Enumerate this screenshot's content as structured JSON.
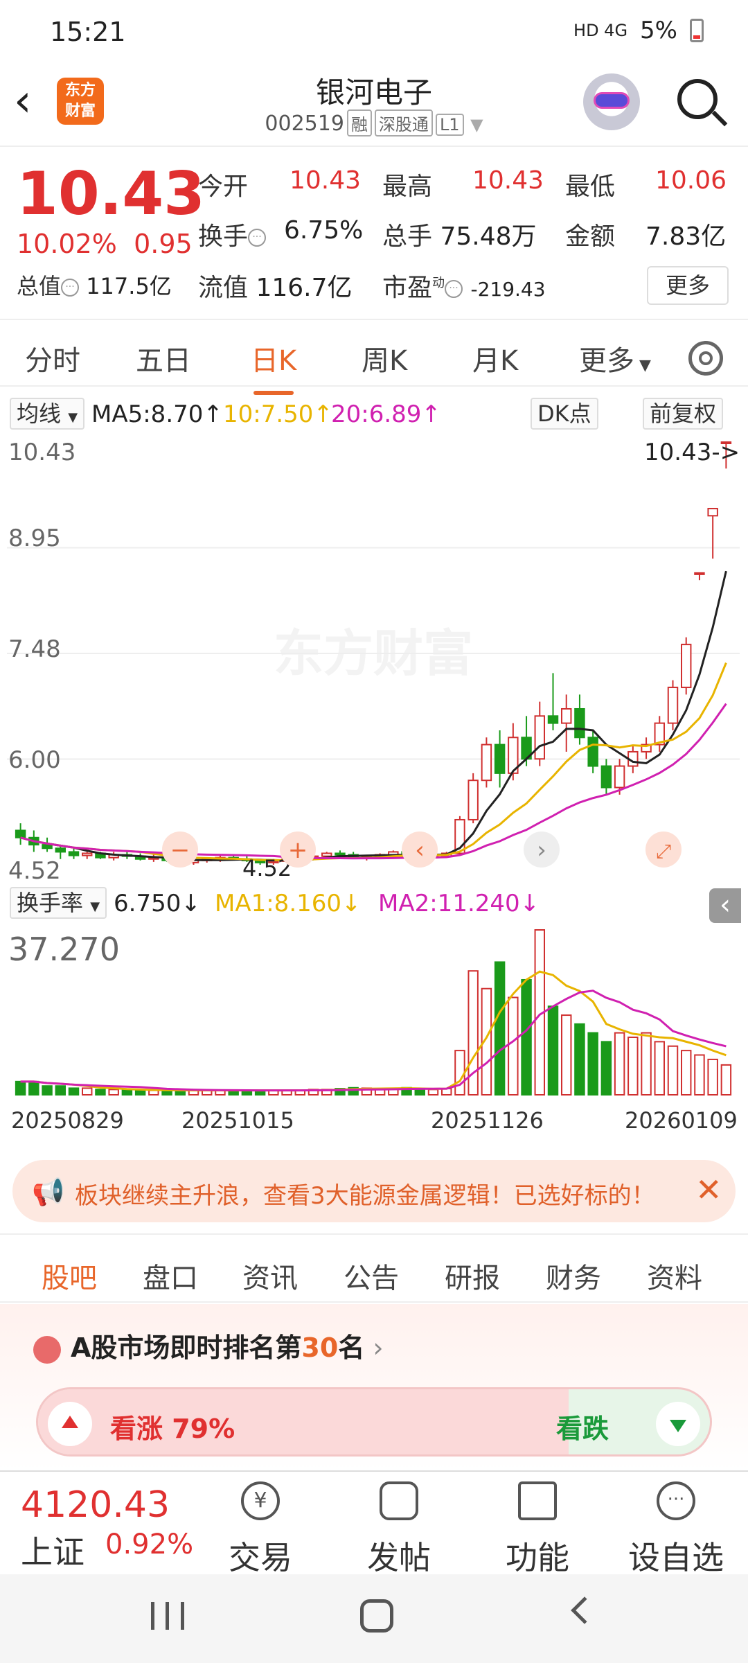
{
  "status_bar": {
    "time": "15:21",
    "signal": "HD 4G",
    "battery": "5%"
  },
  "header": {
    "back_icon": "chevron-left-icon",
    "logo_line1": "东方",
    "logo_line2": "财富",
    "stock_name": "银河电子",
    "stock_code": "002519",
    "tags": [
      "融",
      "深股通",
      "L1"
    ]
  },
  "quote": {
    "price": "10.43",
    "change_pct": "10.02%",
    "change_amt": "0.95",
    "open_label": "今开",
    "open": "10.43",
    "high_label": "最高",
    "high": "10.43",
    "low_label": "最低",
    "low": "10.06",
    "turnover_label": "换手",
    "turnover": "6.75%",
    "volume_label": "总手",
    "volume": "75.48万",
    "amount_label": "金额",
    "amount": "7.83亿",
    "mktcap_label": "总值",
    "mktcap": "117.5亿",
    "float_label": "流值",
    "float": "116.7亿",
    "pe_label": "市盈",
    "pe_super": "动",
    "pe": "-219.43",
    "more": "更多"
  },
  "chart_tabs": [
    "分时",
    "五日",
    "日K",
    "周K",
    "月K",
    "更多"
  ],
  "chart_tab_active": 2,
  "ma_legend": {
    "selector": "均线",
    "ma5": "MA5:8.70",
    "ma10": "10:7.50",
    "ma20": "20:6.89",
    "dk_button": "DK点",
    "adjust_button": "前复权",
    "colors": {
      "ma5": "#222222",
      "ma10": "#e8b400",
      "ma20": "#d020b0"
    }
  },
  "kline_axis": {
    "labels": [
      "10.43",
      "8.95",
      "7.48",
      "6.00",
      "4.52"
    ],
    "last_price_tag": "10.43->",
    "min_marker": "4.52",
    "watermark": "东方财富"
  },
  "volume_legend": {
    "selector": "换手率",
    "value": "6.750",
    "ma1": "MA1:8.160",
    "ma2": "MA2:11.240",
    "axis_max": "37.270"
  },
  "date_labels": [
    "20250829",
    "20251015",
    "20251126",
    "20260109"
  ],
  "chart_data": {
    "type": "candlestick",
    "ylim": [
      4.52,
      10.43
    ],
    "ohlc": [
      [
        5.0,
        5.1,
        4.8,
        4.9
      ],
      [
        4.9,
        5.0,
        4.7,
        4.8
      ],
      [
        4.8,
        4.9,
        4.7,
        4.75
      ],
      [
        4.75,
        4.8,
        4.6,
        4.7
      ],
      [
        4.7,
        4.75,
        4.6,
        4.65
      ],
      [
        4.65,
        4.7,
        4.6,
        4.68
      ],
      [
        4.68,
        4.7,
        4.6,
        4.62
      ],
      [
        4.62,
        4.7,
        4.58,
        4.66
      ],
      [
        4.66,
        4.7,
        4.6,
        4.64
      ],
      [
        4.64,
        4.68,
        4.58,
        4.6
      ],
      [
        4.6,
        4.66,
        4.56,
        4.62
      ],
      [
        4.62,
        4.66,
        4.56,
        4.58
      ],
      [
        4.58,
        4.62,
        4.52,
        4.55
      ],
      [
        4.55,
        4.6,
        4.52,
        4.58
      ],
      [
        4.58,
        4.62,
        4.55,
        4.6
      ],
      [
        4.6,
        4.65,
        4.56,
        4.62
      ],
      [
        4.62,
        4.66,
        4.58,
        4.6
      ],
      [
        4.6,
        4.64,
        4.56,
        4.58
      ],
      [
        4.58,
        4.6,
        4.52,
        4.55
      ],
      [
        4.55,
        4.6,
        4.52,
        4.57
      ],
      [
        4.57,
        4.62,
        4.54,
        4.6
      ],
      [
        4.6,
        4.64,
        4.58,
        4.62
      ],
      [
        4.62,
        4.66,
        4.6,
        4.64
      ],
      [
        4.64,
        4.7,
        4.62,
        4.68
      ],
      [
        4.68,
        4.72,
        4.64,
        4.66
      ],
      [
        4.66,
        4.7,
        4.6,
        4.62
      ],
      [
        4.62,
        4.66,
        4.58,
        4.64
      ],
      [
        4.64,
        4.68,
        4.62,
        4.66
      ],
      [
        4.66,
        4.72,
        4.64,
        4.7
      ],
      [
        4.7,
        4.74,
        4.66,
        4.68
      ],
      [
        4.68,
        4.7,
        4.6,
        4.62
      ],
      [
        4.62,
        4.66,
        4.58,
        4.64
      ],
      [
        4.64,
        4.7,
        4.62,
        4.68
      ],
      [
        4.68,
        5.2,
        4.66,
        5.15
      ],
      [
        5.15,
        5.8,
        5.1,
        5.7
      ],
      [
        5.7,
        6.3,
        5.6,
        6.2
      ],
      [
        6.2,
        6.4,
        5.6,
        5.8
      ],
      [
        5.8,
        6.5,
        5.7,
        6.3
      ],
      [
        6.3,
        6.6,
        5.9,
        6.0
      ],
      [
        6.0,
        6.8,
        5.9,
        6.6
      ],
      [
        6.6,
        7.2,
        6.4,
        6.5
      ],
      [
        6.5,
        6.9,
        6.1,
        6.7
      ],
      [
        6.7,
        6.9,
        6.2,
        6.3
      ],
      [
        6.3,
        6.4,
        5.8,
        5.9
      ],
      [
        5.9,
        6.0,
        5.5,
        5.6
      ],
      [
        5.6,
        6.0,
        5.5,
        5.9
      ],
      [
        5.9,
        6.2,
        5.8,
        6.1
      ],
      [
        6.1,
        6.3,
        6.0,
        6.2
      ],
      [
        6.2,
        6.6,
        6.1,
        6.5
      ],
      [
        6.5,
        7.1,
        6.4,
        7.0
      ],
      [
        7.0,
        7.7,
        6.9,
        7.6
      ],
      [
        8.6,
        8.6,
        8.5,
        8.6
      ],
      [
        9.4,
        9.5,
        8.8,
        9.5
      ],
      [
        10.43,
        10.43,
        10.06,
        10.43
      ]
    ],
    "turnover": [
      3,
      3,
      2,
      2,
      1.5,
      1.5,
      1.2,
      1.2,
      1.1,
      1,
      1,
      1,
      1,
      1,
      1,
      1,
      1,
      1,
      1,
      1,
      1,
      1,
      1.2,
      1.2,
      1.4,
      1.6,
      1.5,
      1.3,
      1.4,
      1.6,
      1.3,
      1.2,
      1.4,
      10,
      28,
      24,
      30,
      22,
      26,
      37.27,
      20,
      18,
      16,
      14,
      12,
      14,
      13,
      14,
      12,
      11,
      10,
      9,
      8,
      6.75
    ],
    "ma5_color": "#222222",
    "ma10_color": "#e8b400",
    "ma20_color": "#d020b0"
  },
  "banner": {
    "text": "板块继续主升浪，查看3大能源金属逻辑！已选好标的！",
    "close_icon": "close-icon"
  },
  "info_tabs": [
    "股吧",
    "盘口",
    "资讯",
    "公告",
    "研报",
    "财务",
    "资料"
  ],
  "info_tab_active": 0,
  "ranking": {
    "prefix": "A股市场即时排名第",
    "rank": "30",
    "suffix": "名"
  },
  "vote": {
    "up_label": "看涨 79%",
    "up_pct": 0.79,
    "down_label": "看跌"
  },
  "toolbar": {
    "index_value": "4120.43",
    "index_name": "上证",
    "index_change": "0.92%",
    "items": [
      "交易",
      "发帖",
      "功能",
      "设自选"
    ]
  }
}
